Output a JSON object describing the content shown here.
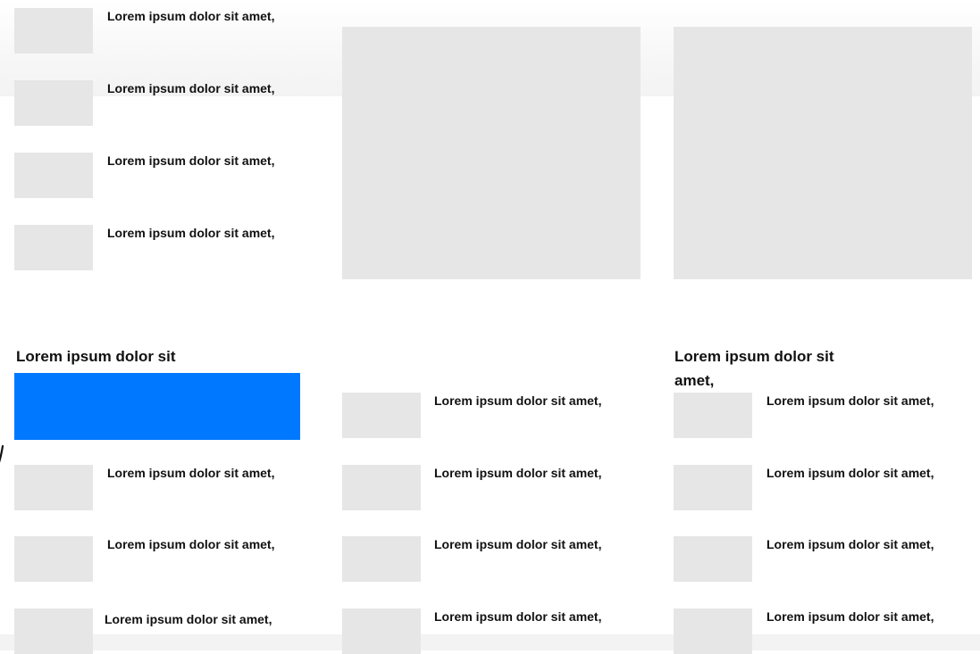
{
  "top_list": {
    "items": [
      {
        "text": "Lorem ipsum dolor sit amet,"
      },
      {
        "text": "Lorem ipsum dolor sit amet,"
      },
      {
        "text": "Lorem ipsum dolor sit amet,"
      },
      {
        "text": "Lorem ipsum dolor sit amet,"
      }
    ]
  },
  "section_left": {
    "title": "Lorem ipsum dolor sit",
    "items": [
      {
        "text": "Lorem ipsum dolor sit amet,"
      },
      {
        "text": "Lorem ipsum dolor sit amet,"
      },
      {
        "text": "Lorem ipsum dolor sit amet,"
      }
    ]
  },
  "section_middle": {
    "items": [
      {
        "text": "Lorem ipsum dolor sit amet,"
      },
      {
        "text": "Lorem ipsum dolor sit amet,"
      },
      {
        "text": "Lorem ipsum dolor sit amet,"
      },
      {
        "text": "Lorem ipsum dolor sit amet,"
      }
    ]
  },
  "section_right": {
    "title_line1": "Lorem ipsum dolor sit",
    "title_line2": "amet,",
    "items": [
      {
        "text": "Lorem ipsum dolor sit amet,"
      },
      {
        "text": "Lorem ipsum dolor sit amet,"
      },
      {
        "text": "Lorem ipsum dolor sit amet,"
      },
      {
        "text": "Lorem ipsum dolor sit amet,"
      }
    ]
  },
  "colors": {
    "accent": "#0078ff",
    "placeholder": "#e6e6e6"
  }
}
